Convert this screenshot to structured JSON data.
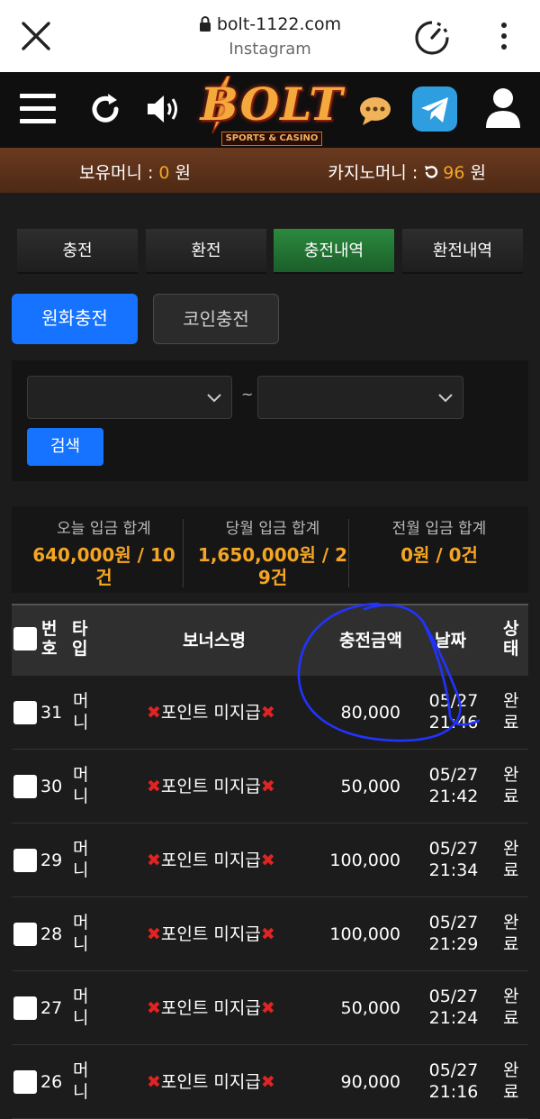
{
  "browser": {
    "url": "bolt-1122.com",
    "subtitle": "Instagram"
  },
  "header": {
    "logo_main": "BOLT",
    "logo_sub": "SPORTS & CASINO"
  },
  "balance": {
    "money_label": "보유머니 : ",
    "money_value": "0",
    "money_unit": " 원",
    "casino_label": "카지노머니 : ",
    "casino_value": "96",
    "casino_unit": " 원"
  },
  "tabs": [
    {
      "label": "충전"
    },
    {
      "label": "환전"
    },
    {
      "label": "충전내역"
    },
    {
      "label": "환전내역"
    }
  ],
  "sub_tabs": {
    "won": "원화충전",
    "coin": "코인충전"
  },
  "filter": {
    "tilde": "~",
    "search": "검색"
  },
  "summary": [
    {
      "label": "오늘 입금 합계",
      "value": "640,000원 / 10건"
    },
    {
      "label": "당월 입금 합계",
      "value": "1,650,000원 / 29건"
    },
    {
      "label": "전월 입금 합계",
      "value": "0원 / 0건"
    }
  ],
  "table": {
    "headers": {
      "no": "번호",
      "type": "타입",
      "bonus": "보너스명",
      "amount": "충전금액",
      "date": "날짜",
      "status": "상태"
    },
    "rows": [
      {
        "no": "31",
        "type": "머니",
        "bonus": "포인트 미지급",
        "amount": "80,000",
        "date": "05/27",
        "time": "21:46",
        "status": "완료"
      },
      {
        "no": "30",
        "type": "머니",
        "bonus": "포인트 미지급",
        "amount": "50,000",
        "date": "05/27",
        "time": "21:42",
        "status": "완료"
      },
      {
        "no": "29",
        "type": "머니",
        "bonus": "포인트 미지급",
        "amount": "100,000",
        "date": "05/27",
        "time": "21:34",
        "status": "완료"
      },
      {
        "no": "28",
        "type": "머니",
        "bonus": "포인트 미지급",
        "amount": "100,000",
        "date": "05/27",
        "time": "21:29",
        "status": "완료"
      },
      {
        "no": "27",
        "type": "머니",
        "bonus": "포인트 미지급",
        "amount": "50,000",
        "date": "05/27",
        "time": "21:24",
        "status": "완료"
      },
      {
        "no": "26",
        "type": "머니",
        "bonus": "포인트 미지급",
        "amount": "90,000",
        "date": "05/27",
        "time": "21:16",
        "status": "완료"
      }
    ]
  },
  "colors": {
    "accent_blue": "#1673ff",
    "accent_green": "#2b8a3e",
    "amount_orange": "#f5a524",
    "cross_red": "#e02424",
    "balance_bar": "#5a3019",
    "annotation_ink": "#2233ff"
  }
}
